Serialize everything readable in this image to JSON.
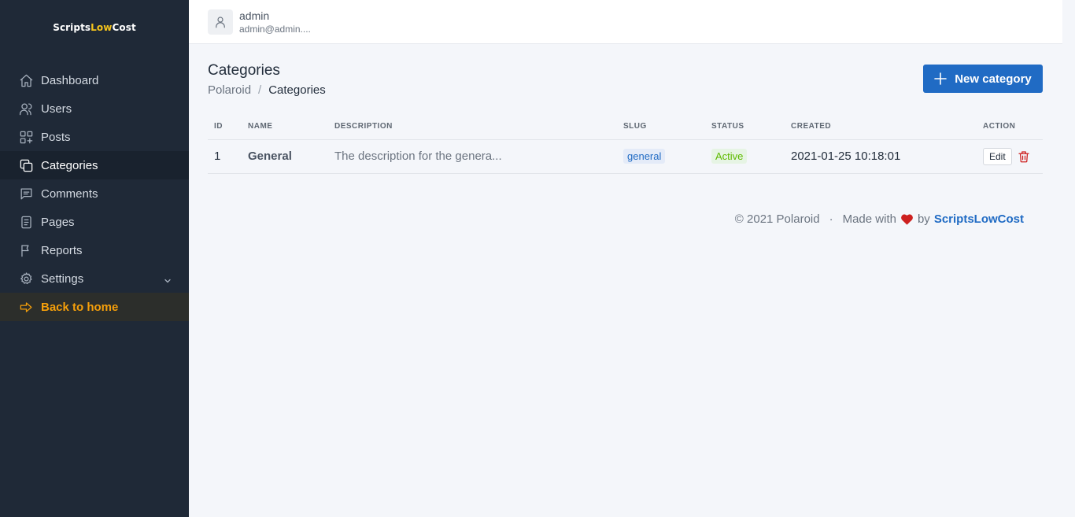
{
  "brand": {
    "part1": "Scripts",
    "part2": "Low",
    "part3": "Cost"
  },
  "sidebar": {
    "items": [
      {
        "label": "Dashboard",
        "icon": "home-icon"
      },
      {
        "label": "Users",
        "icon": "users-icon"
      },
      {
        "label": "Posts",
        "icon": "grid-plus-icon"
      },
      {
        "label": "Categories",
        "icon": "copy-icon",
        "active": true
      },
      {
        "label": "Comments",
        "icon": "message-icon"
      },
      {
        "label": "Pages",
        "icon": "file-icon"
      },
      {
        "label": "Reports",
        "icon": "flag-icon"
      },
      {
        "label": "Settings",
        "icon": "gear-icon"
      },
      {
        "label": "Back to home",
        "icon": "arrow-right-icon"
      }
    ]
  },
  "user": {
    "name": "admin",
    "email": "admin@admin...."
  },
  "page": {
    "title": "Categories",
    "breadcrumb": [
      "Polaroid",
      "Categories"
    ],
    "breadcrumb_sep": "/",
    "new_button": "New category"
  },
  "table": {
    "headers": [
      "ID",
      "NAME",
      "DESCRIPTION",
      "SLUG",
      "STATUS",
      "CREATED",
      "ACTION"
    ],
    "rows": [
      {
        "id": "1",
        "name": "General",
        "description": "The description for the genera...",
        "slug": "general",
        "status": "Active",
        "created": "2021-01-25 10:18:01",
        "edit": "Edit"
      }
    ]
  },
  "footer": {
    "copyright": "© 2021 Polaroid",
    "sep": "·",
    "made_with": "Made with",
    "by": "by",
    "author": "ScriptsLowCost"
  },
  "colors": {
    "sidebar_bg": "#1f2937",
    "accent": "#206bc4",
    "back_link": "#f59f0a",
    "brand_highlight": "#f5c41c",
    "danger": "#cd201f",
    "success": "#5eba00"
  }
}
